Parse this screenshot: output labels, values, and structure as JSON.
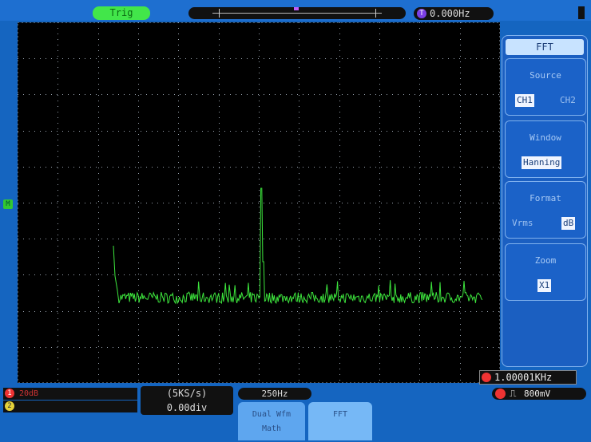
{
  "top": {
    "trigger_label": "Trig",
    "freq_marker": "T",
    "freq_value": "0.000Hz"
  },
  "channel_marker": "M",
  "fft_menu": {
    "title": "FFT",
    "source": {
      "title": "Source",
      "options": [
        "CH1",
        "CH2"
      ],
      "selected": "CH1"
    },
    "window": {
      "title": "Window",
      "value": "Hanning"
    },
    "format": {
      "title": "Format",
      "options": [
        "Vrms",
        "dB"
      ],
      "selected": "dB"
    },
    "zoom": {
      "title": "Zoom",
      "value": "X1"
    }
  },
  "freq_readout": "1.00001KHz",
  "bottom": {
    "ch1_marker": "1",
    "ch1_label": "20dB",
    "ch2_marker": "2",
    "sample_rate": "(5KS/s)",
    "offset": "0.00div",
    "hz_per_div": "250Hz",
    "trigger_level": "800mV"
  },
  "tabs": [
    {
      "line1": "Dual Wfm",
      "line2": "Math"
    },
    {
      "line1": "FFT",
      "line2": ""
    }
  ],
  "colors": {
    "trace": "#3de63d",
    "grid_dots": "#9aa4b0",
    "background": "#1565c0"
  }
}
